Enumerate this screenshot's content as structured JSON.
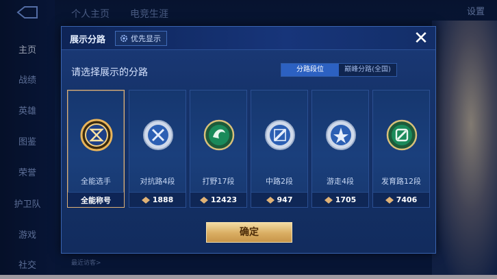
{
  "background": {
    "nav_items": [
      "主页",
      "战绩",
      "英雄",
      "图鉴",
      "荣誉",
      "护卫队",
      "游戏",
      "社交"
    ],
    "top_tabs": [
      "个人主页",
      "电竞生涯"
    ],
    "settings_label": "设置",
    "recent_visitors_label": "最近访客>"
  },
  "dialog": {
    "title": "展示分路",
    "priority_label": "优先显示",
    "close_symbol": "✕",
    "subtitle": "请选择展示的分路",
    "segments": [
      "分路段位",
      "巅峰分路(全国)"
    ],
    "active_segment": 0,
    "cards": [
      {
        "name": "全能选手",
        "footer": "全能称号",
        "badge_icon": "all-rounder-badge-icon",
        "selected": true
      },
      {
        "name": "对抗路4段",
        "points": "1888",
        "badge_icon": "clash-lane-badge-icon"
      },
      {
        "name": "打野17段",
        "points": "12423",
        "badge_icon": "jungle-badge-icon"
      },
      {
        "name": "中路2段",
        "points": "947",
        "badge_icon": "mid-lane-badge-icon"
      },
      {
        "name": "游走4段",
        "points": "1705",
        "badge_icon": "roam-badge-icon"
      },
      {
        "name": "发育路12段",
        "points": "7406",
        "badge_icon": "farm-lane-badge-icon"
      }
    ],
    "confirm_label": "确定"
  },
  "colors": {
    "accent_gold": "#e0b276",
    "panel_blue": "#16336b",
    "segment_active": "#2c61c2"
  }
}
